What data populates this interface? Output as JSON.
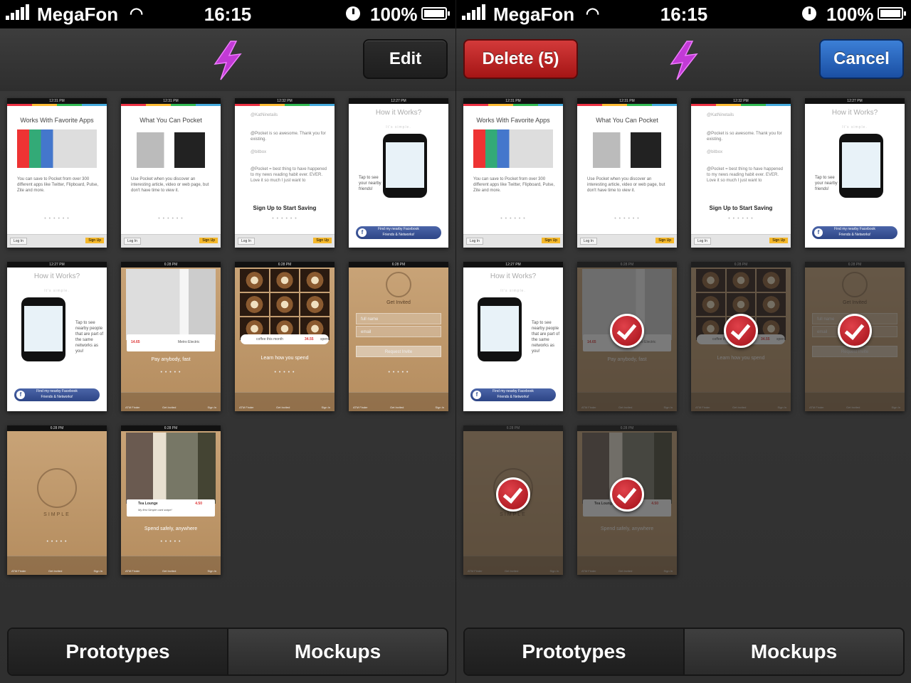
{
  "status_bar": {
    "carrier": "MegaFon",
    "time": "16:15",
    "battery": "100%"
  },
  "left": {
    "edit_label": "Edit",
    "tabs": [
      {
        "label": "Prototypes",
        "active": true
      },
      {
        "label": "Mockups",
        "active": false
      }
    ]
  },
  "right": {
    "delete_label": "Delete (5)",
    "cancel_label": "Cancel",
    "tabs": [
      {
        "label": "Prototypes",
        "active": true
      },
      {
        "label": "Mockups",
        "active": false
      }
    ]
  },
  "thumbs": {
    "status_a": {
      "carrier": "VF CZ",
      "time": "12:31 PM"
    },
    "status_b": {
      "carrier": "VF CZ",
      "time": "12:32 PM"
    },
    "status_c": {
      "carrier": "VF CZ",
      "time": "12:27 PM"
    },
    "status_d": {
      "carrier": "VF CZ",
      "time": "6:28 PM"
    },
    "favorite_apps": {
      "title": "Works With Favorite Apps",
      "body": "You can save to Pocket from over 300 different apps like Twitter, Flipboard, Pulse, Zite and more.",
      "login": "Log In",
      "signup": "Sign Up"
    },
    "what_pocket": {
      "title": "What You Can Pocket",
      "body": "Use Pocket when you discover an interesting article, video or web page, but don't have time to view it."
    },
    "sign_up": {
      "handle1": "@KatNinetails",
      "quote1": "@Pocket is so awesome. Thank you for existing.",
      "handle2": "@bitbox",
      "quote2": "@Pocket = best thing to have happened to my news reading habit ever. EVER. Love it so much I just want to",
      "cta": "Sign Up to Start Saving"
    },
    "how_works": {
      "title": "How it Works?",
      "subtitle": "It's simple.",
      "tap": "Tap to see your nearby friends!",
      "tap_long": "Tap to see nearby people that are part of the same networks as you!",
      "fb_line1": "Find my nearby Facebook",
      "fb_line2": "Friends & Networks!"
    },
    "pay": {
      "amount": "14.65",
      "merchant": "Metro Electric",
      "caption": "Pay anybody, fast"
    },
    "learn": {
      "chip": "coffee this month",
      "amount": "34.55",
      "unit": "spent",
      "caption": "Learn how you spend"
    },
    "invited": {
      "title": "Get Invited",
      "name_ph": "full name",
      "email_ph": "email",
      "request": "Request Invite"
    },
    "simple": {
      "brand": "SIMPLE"
    },
    "spend": {
      "merchant": "Tea Lounge",
      "note": "My first Simple card swipe!",
      "amount": "4.50",
      "caption": "Spend safely, anywhere"
    },
    "tabbar": {
      "atm": "ATM Finder",
      "invited": "Get Invited",
      "sign_in": "Sign In"
    }
  }
}
